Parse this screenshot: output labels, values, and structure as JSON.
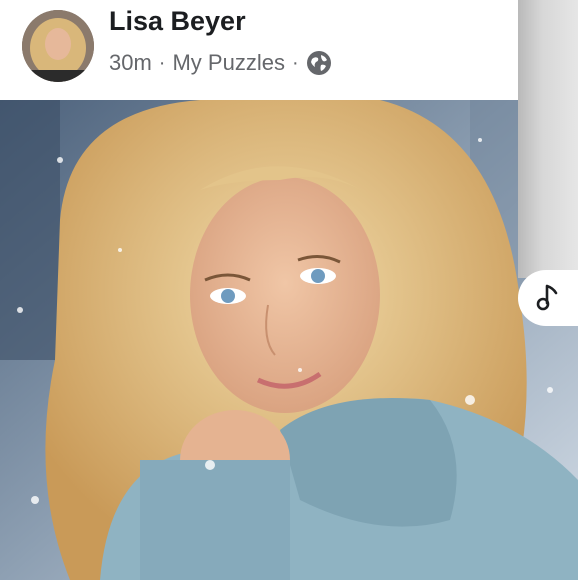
{
  "post": {
    "author_name": "Lisa Beyer",
    "time_ago": "30m",
    "separator": "·",
    "group_name": "My Puzzles",
    "audience_icon": "globe-icon"
  },
  "side_panel": {
    "music_icon": "music-note-icon"
  },
  "colors": {
    "name_text": "#1c1e21",
    "meta_text": "#65676b",
    "header_bg": "#ffffff"
  }
}
